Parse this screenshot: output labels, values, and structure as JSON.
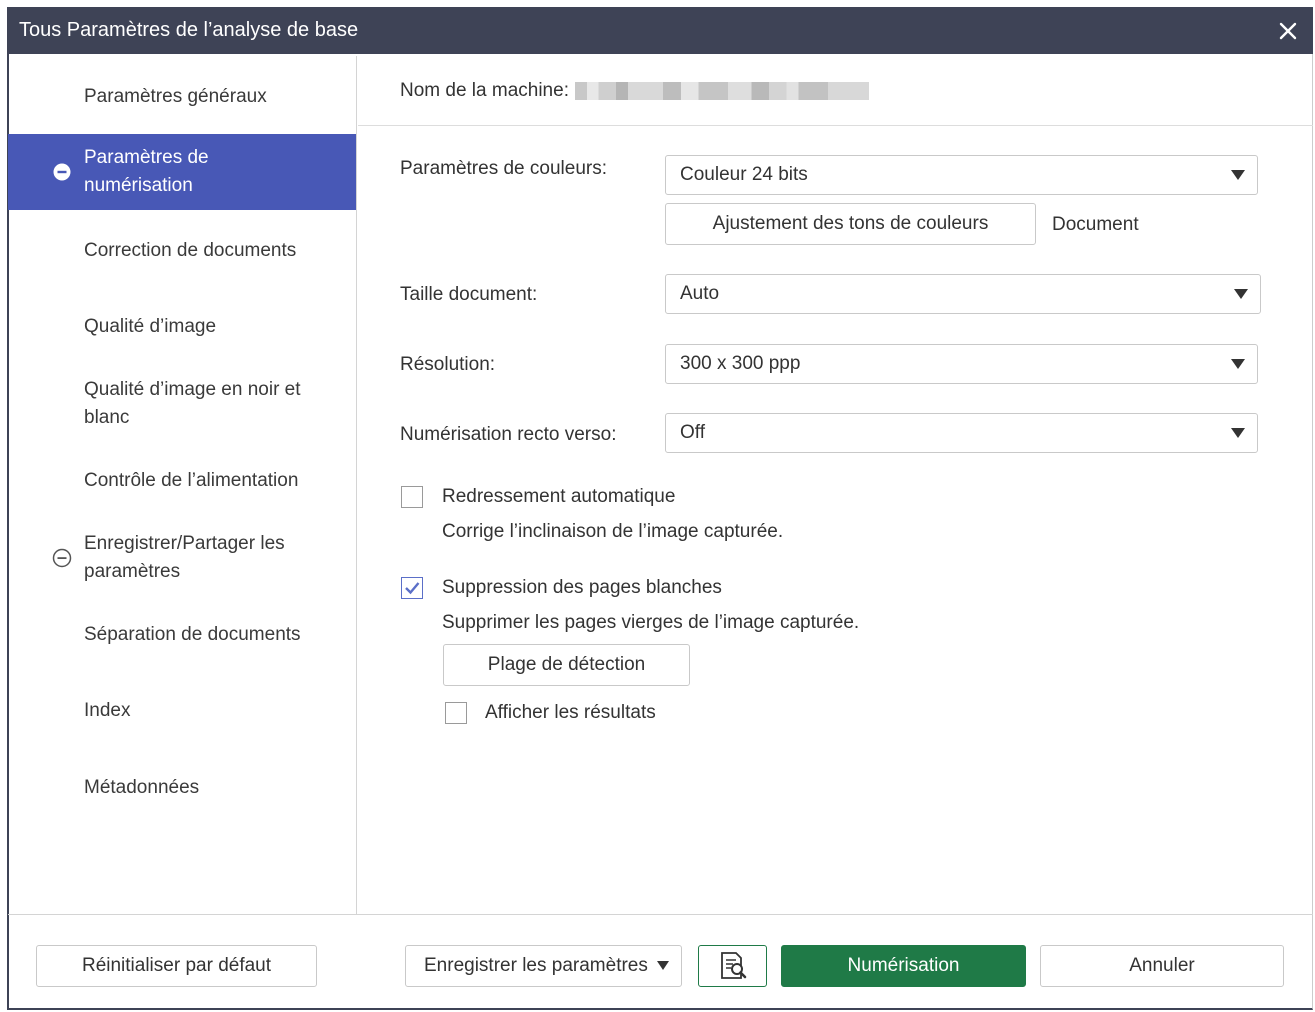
{
  "window": {
    "title": "Tous Paramètres de l’analyse de base"
  },
  "sidebar": {
    "items": [
      {
        "label": "Paramètres généraux"
      },
      {
        "label": "Paramètres de numérisation"
      },
      {
        "label": "Correction de documents"
      },
      {
        "label": "Qualité d’image"
      },
      {
        "label": "Qualité d’image en noir et blanc"
      },
      {
        "label": "Contrôle de l’alimentation"
      },
      {
        "label": "Enregistrer/Partager les paramètres"
      },
      {
        "label": "Séparation de documents"
      },
      {
        "label": "Index"
      },
      {
        "label": "Métadonnées"
      }
    ]
  },
  "main": {
    "machine_label": "Nom de la machine:",
    "color": {
      "label": "Paramètres de couleurs:",
      "value": "Couleur 24 bits",
      "adjust_button": "Ajustement des tons de couleurs",
      "document_label": "Document"
    },
    "size": {
      "label": "Taille document:",
      "value": "Auto"
    },
    "resolution": {
      "label": "Résolution:",
      "value": "300 x 300 ppp"
    },
    "duplex": {
      "label": "Numérisation recto verso:",
      "value": "Off"
    },
    "auto_deskew": {
      "label": "Redressement automatique",
      "description": "Corrige l’inclinaison de l’image capturée.",
      "checked": false
    },
    "blank_page": {
      "label": "Suppression des pages blanches",
      "description": "Supprimer les pages vierges de l’image capturée.",
      "checked": true,
      "range_button": "Plage de détection",
      "show_results_label": "Afficher les résultats",
      "show_results_checked": false
    }
  },
  "footer": {
    "reset_button": "Réinitialiser par défaut",
    "save_button": "Enregistrer les paramètres",
    "scan_button": "Numérisation",
    "cancel_button": "Annuler"
  },
  "colors": {
    "titlebar": "#3e4356",
    "active_item": "#4858b6",
    "primary_button": "#1f7a47",
    "checkbox_check": "#5b6fc8"
  }
}
